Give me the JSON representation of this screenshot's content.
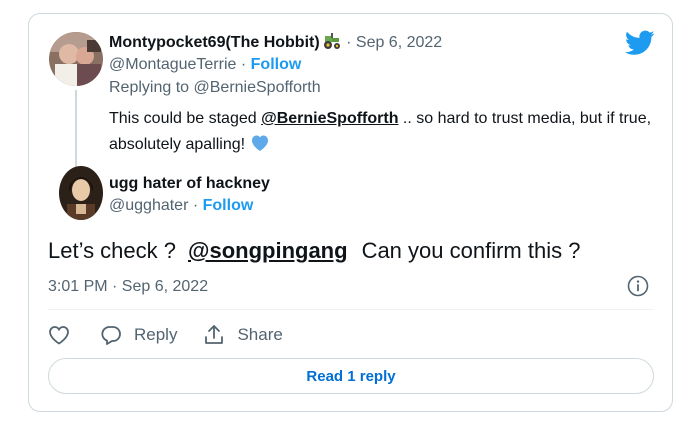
{
  "quoted": {
    "name": "Montypocket69(The Hobbit)",
    "name_emoji": "tractor-icon",
    "date_sep": " · ",
    "date": "Sep 6, 2022",
    "handle": "@MontagueTerrie",
    "handle_sep": " · ",
    "follow_label": "Follow",
    "replying_prefix": "Replying to ",
    "replying_to": "@BernieSpofforth",
    "text_before": "This could be staged ",
    "text_mention": "@BernieSpofforth",
    "text_after": " .. so hard to trust media, but if true, absolutely apalling! ",
    "text_emoji": "blue-heart-icon"
  },
  "main": {
    "name": "ugg hater of hackney",
    "handle": "@ugghater",
    "handle_sep": " · ",
    "follow_label": "Follow",
    "text_before": "Let’s check ?",
    "text_mention": "@songpingang",
    "text_after": "Can you confirm this ?",
    "timestamp": "3:01 PM · Sep 6, 2022"
  },
  "actions": {
    "like_icon": "heart-outline-icon",
    "reply_label": "Reply",
    "share_label": "Share"
  },
  "read_replies_label": "Read 1 reply",
  "colors": {
    "accent": "#1d9bf0",
    "link": "#006fd6",
    "muted": "#536471",
    "border": "#cfd9de"
  }
}
